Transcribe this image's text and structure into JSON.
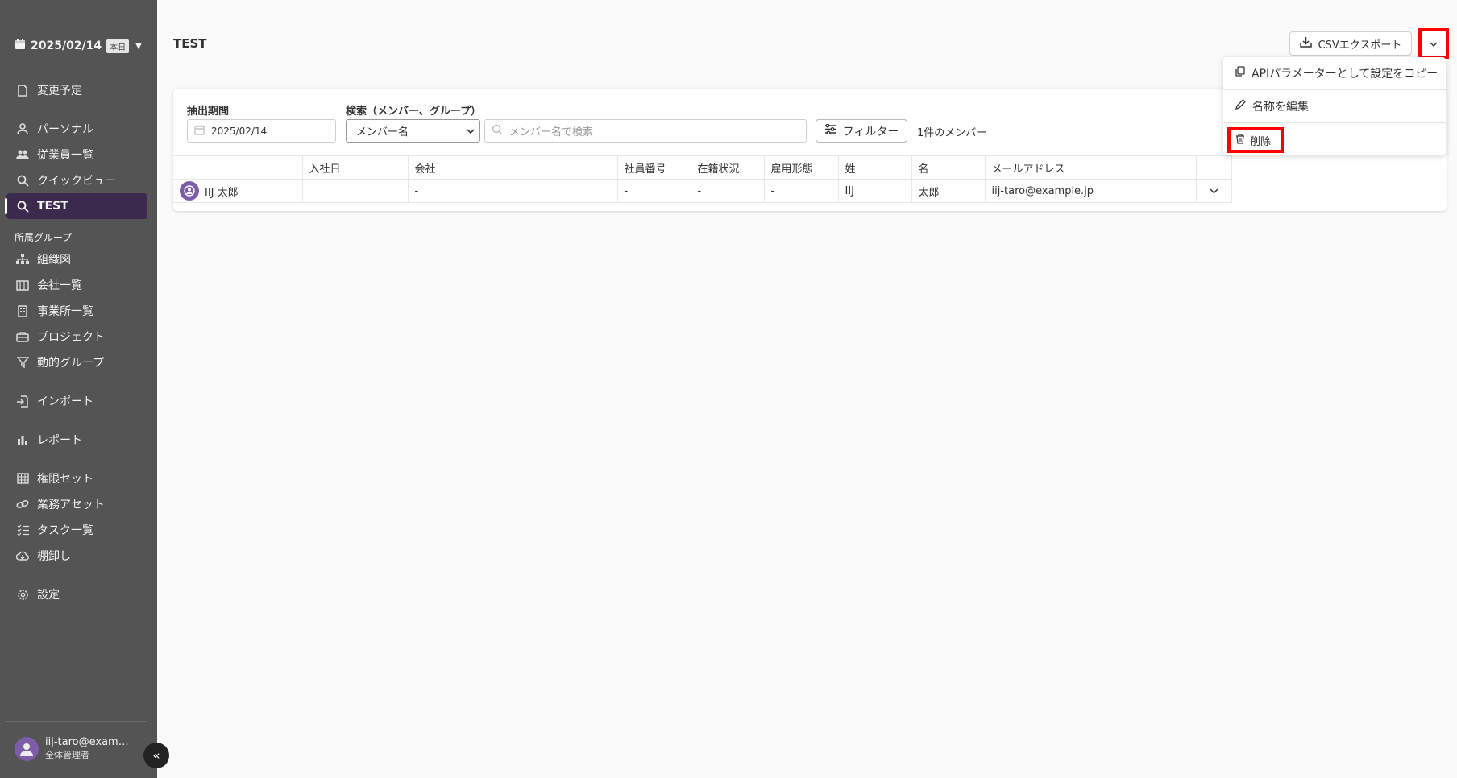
{
  "sidebar": {
    "date": "2025/02/14",
    "today_badge": "本日",
    "items": [
      {
        "label": "変更予定",
        "icon": "document-icon"
      },
      {
        "label": "パーソナル",
        "icon": "person-icon"
      },
      {
        "label": "従業員一覧",
        "icon": "people-icon"
      },
      {
        "label": "クイックビュー",
        "icon": "search-icon"
      },
      {
        "label": "TEST",
        "icon": "search-icon",
        "active": true
      }
    ],
    "group_label": "所属グループ",
    "group_items": [
      {
        "label": "組織図",
        "icon": "org-chart-icon"
      },
      {
        "label": "会社一覧",
        "icon": "building-icon"
      },
      {
        "label": "事業所一覧",
        "icon": "office-icon"
      },
      {
        "label": "プロジェクト",
        "icon": "briefcase-icon"
      },
      {
        "label": "動的グループ",
        "icon": "funnel-icon"
      }
    ],
    "import_label": "インポート",
    "report_label": "レポート",
    "admin_items": [
      {
        "label": "権限セット",
        "icon": "grid-icon"
      },
      {
        "label": "業務アセット",
        "icon": "link-icon"
      },
      {
        "label": "タスク一覧",
        "icon": "checklist-icon"
      },
      {
        "label": "棚卸し",
        "icon": "cloud-icon"
      }
    ],
    "settings_label": "設定",
    "user": {
      "email": "iij-taro@example.jp",
      "role": "全体管理者"
    }
  },
  "header": {
    "title": "TEST",
    "csv_export": "CSVエクスポート"
  },
  "filters": {
    "period_label": "抽出期間",
    "period_value": "2025/02/14",
    "search_label": "検索（メンバー、グループ）",
    "search_type": "メンバー名",
    "search_placeholder": "メンバー名で検索",
    "filter_button": "フィルター",
    "member_count": "1件のメンバー"
  },
  "table": {
    "columns": [
      "",
      "入社日",
      "会社",
      "社員番号",
      "在籍状況",
      "雇用形態",
      "姓",
      "名",
      "メールアドレス",
      ""
    ],
    "rows": [
      {
        "name": "IIJ 太郎",
        "hire_date": "",
        "company": "-",
        "employee_no": "-",
        "status": "-",
        "employment_type": "-",
        "last_name": "IIJ",
        "first_name": "太郎",
        "email": "iij-taro@example.jp"
      }
    ]
  },
  "menu": {
    "copy_api": "APIパラメーターとして設定をコピー",
    "edit_name": "名称を編集",
    "delete": "削除"
  }
}
